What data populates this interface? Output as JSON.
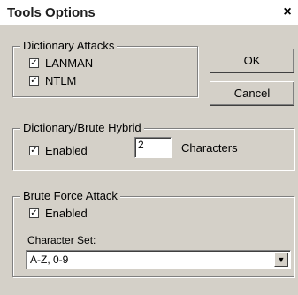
{
  "window": {
    "title": "Tools Options",
    "close_glyph": "×"
  },
  "dictionary_attacks": {
    "legend": "Dictionary Attacks",
    "lanman": {
      "label": "LANMAN",
      "checked": true
    },
    "ntlm": {
      "label": "NTLM",
      "checked": true
    }
  },
  "buttons": {
    "ok": "OK",
    "cancel": "Cancel"
  },
  "hybrid": {
    "legend": "Dictionary/Brute Hybrid",
    "enabled": {
      "label": "Enabled",
      "checked": true
    },
    "characters_value": "2",
    "characters_label": "Characters"
  },
  "brute_force": {
    "legend": "Brute Force Attack",
    "enabled": {
      "label": "Enabled",
      "checked": true
    },
    "charset_label": "Character Set:",
    "charset_value": "A-Z, 0-9"
  },
  "icons": {
    "check": "✓",
    "dropdown": "▼"
  }
}
